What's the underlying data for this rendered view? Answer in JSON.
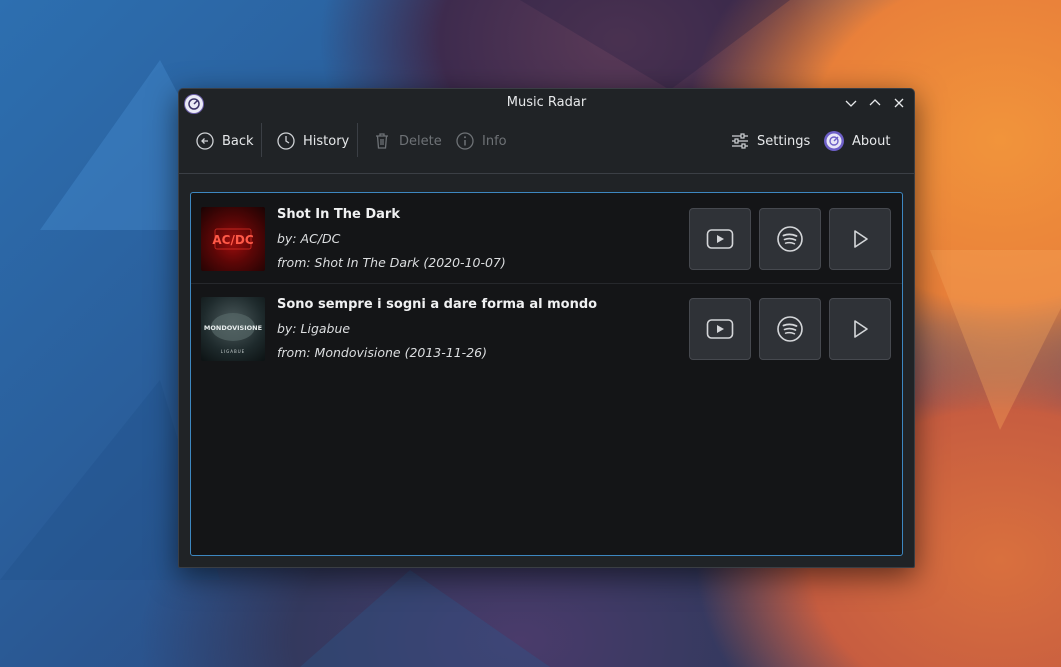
{
  "window": {
    "title": "Music Radar"
  },
  "toolbar": {
    "back_label": "Back",
    "history_label": "History",
    "delete_label": "Delete",
    "info_label": "Info",
    "settings_label": "Settings",
    "about_label": "About"
  },
  "songs": [
    {
      "title": "Shot In The Dark",
      "artist": "by: AC/DC",
      "album": "from: Shot In The Dark (2020-10-07)",
      "cover_text": "AC/DC"
    },
    {
      "title": "Sono sempre i sogni a dare forma al mondo",
      "artist": "by: Ligabue",
      "album": "from: Mondovisione (2013-11-26)",
      "cover_text": "MONDOVISIONE",
      "cover_subtext": "LIGABUE"
    }
  ],
  "colors": {
    "accent": "#3d87c0",
    "window_bg": "#202326",
    "list_bg": "#141517",
    "button_bg": "#2f3237"
  }
}
